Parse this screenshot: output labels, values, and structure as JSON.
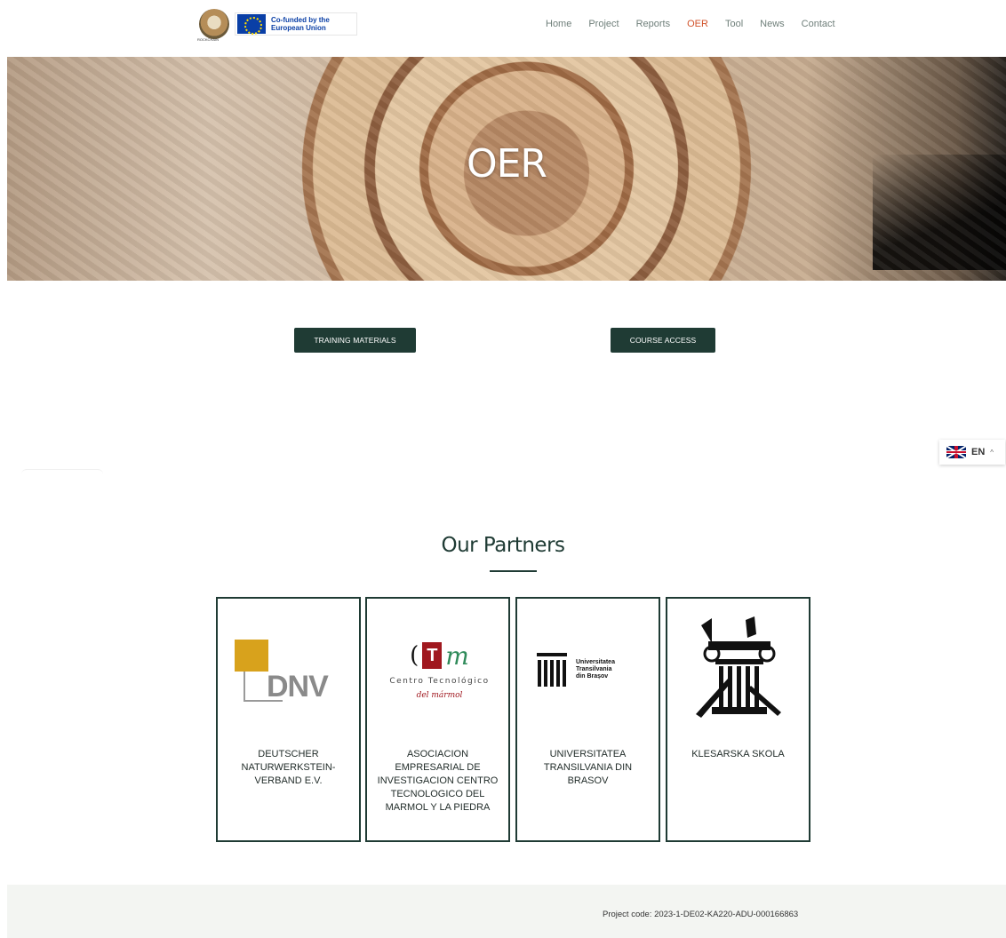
{
  "header": {
    "eu_funding_text": "Co-funded by the European Union",
    "project_logo_text": "ROCKCHAIN",
    "nav": [
      {
        "label": "Home",
        "active": false
      },
      {
        "label": "Project",
        "active": false
      },
      {
        "label": "Reports",
        "active": false
      },
      {
        "label": "OER",
        "active": true
      },
      {
        "label": "Tool",
        "active": false
      },
      {
        "label": "News",
        "active": false
      },
      {
        "label": "Contact",
        "active": false
      }
    ]
  },
  "hero": {
    "title": "OER"
  },
  "buttons": {
    "training_materials": "TRAINING MATERIALS",
    "course_access": "COURSE ACCESS"
  },
  "language": {
    "code": "EN",
    "caret": "^",
    "flag_icon": "uk-flag-icon"
  },
  "partners": {
    "title": "Our Partners",
    "items": [
      {
        "name": "DEUTSCHER NATURWERKSTEIN-VERBAND E.V.",
        "logo_text": "DNV"
      },
      {
        "name": "ASOCIACION EMPRESARIAL DE INVESTIGACION CENTRO TECNOLOGICO DEL MARMOL Y LA PIEDRA",
        "logo_letter": "T",
        "logo_m": "m",
        "logo_line1": "Centro Tecnológico",
        "logo_line2": "del mármol"
      },
      {
        "name": "UNIVERSITATEA TRANSILVANIA DIN BRASOV",
        "logo_text_1": "Universitatea",
        "logo_text_2": "Transilvania",
        "logo_text_3": "din Brașov"
      },
      {
        "name": "KLESARSKA SKOLA"
      }
    ]
  },
  "footer": {
    "project_code": "Project code: 2023-1-DE02-KA220-ADU-000166863"
  },
  "colors": {
    "accent": "#d1522a",
    "primary_dark": "#1f3b34",
    "footer_bg": "#f3f5f2"
  }
}
